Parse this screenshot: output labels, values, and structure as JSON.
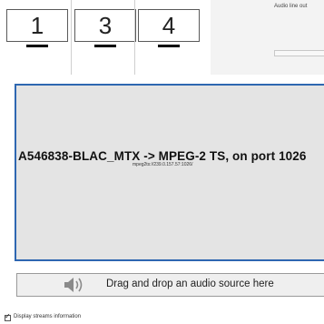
{
  "displays": {
    "items": [
      {
        "label": "1"
      },
      {
        "label": "3"
      },
      {
        "label": "4"
      }
    ]
  },
  "audio_output": {
    "label": "Audio line out"
  },
  "stream": {
    "title": "A546838-BLAC_MTX -> MPEG-2 TS, on port 1026",
    "url": "mpeg2ts://239.0.157.57:1026/",
    "border_color": "#2e67b1"
  },
  "drop_zone": {
    "icon": "speaker-icon",
    "text": "Drag and drop an audio source here"
  },
  "options": {
    "display_streams_info": {
      "label": "Display streams information",
      "checked": true
    }
  }
}
